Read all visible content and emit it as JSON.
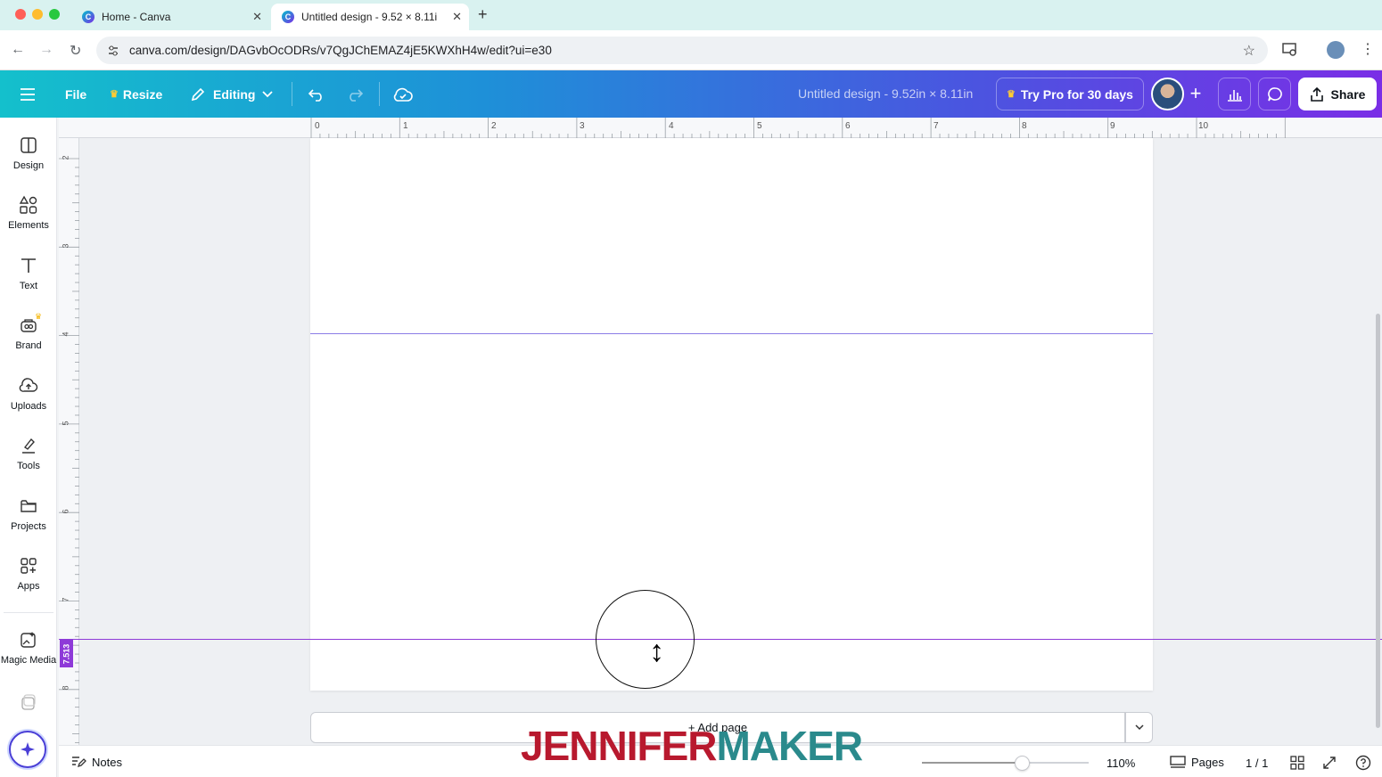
{
  "browser": {
    "tabs": [
      {
        "title": "Home - Canva"
      },
      {
        "title": "Untitled design - 9.52 × 8.11i"
      }
    ],
    "url": "canva.com/design/DAGvbOcODRs/v7QgJChEMAZ4jE5KWXhH4w/edit?ui=e30"
  },
  "header": {
    "file": "File",
    "resize": "Resize",
    "editing": "Editing",
    "design_title": "Untitled design - 9.52in × 8.11in",
    "try_pro": "Try Pro for 30 days",
    "share": "Share"
  },
  "sidebar": {
    "items": [
      {
        "label": "Design",
        "icon": "design-icon"
      },
      {
        "label": "Elements",
        "icon": "elements-icon"
      },
      {
        "label": "Text",
        "icon": "text-icon"
      },
      {
        "label": "Brand",
        "icon": "brand-icon"
      },
      {
        "label": "Uploads",
        "icon": "uploads-icon"
      },
      {
        "label": "Tools",
        "icon": "tools-icon"
      },
      {
        "label": "Projects",
        "icon": "projects-icon"
      },
      {
        "label": "Apps",
        "icon": "apps-icon"
      },
      {
        "label": "Magic Media",
        "icon": "magic-media-icon"
      }
    ]
  },
  "ruler": {
    "top_labels": [
      "0",
      "1",
      "2",
      "3",
      "4",
      "5",
      "6",
      "7",
      "8",
      "9",
      "10"
    ],
    "left_labels": [
      "2",
      "3",
      "4",
      "5",
      "6",
      "7",
      "8"
    ],
    "guide_value": "7.513"
  },
  "canvas": {
    "add_page": "+ Add page"
  },
  "footer": {
    "notes": "Notes",
    "zoom": "110%",
    "zoom_fraction": 0.6,
    "pages": "Pages",
    "page_count": "1 / 1"
  },
  "watermark": {
    "part1": "JENNIFER",
    "part2": "MAKER"
  },
  "colors": {
    "accent": "#8e3ad8",
    "header_start": "#14c0cc",
    "header_end": "#7a2ee6"
  }
}
